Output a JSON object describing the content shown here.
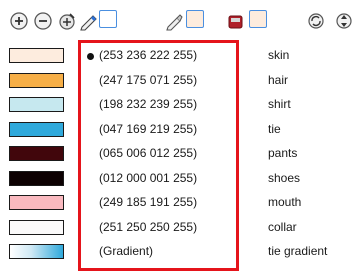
{
  "toolbar": {
    "icons": [
      "add-circle-icon",
      "remove-circle-icon",
      "style-picker-icon",
      "pencil-icon",
      "brush-icon",
      "paint-bucket-icon",
      "recycle-icon",
      "scroll-arrows-icon"
    ]
  },
  "colors": [
    {
      "name": "skin",
      "value": "(253 236 222 255)",
      "swatch": "#fdecde",
      "selected": true
    },
    {
      "name": "hair",
      "value": "(247 175 071 255)",
      "swatch": "#f7af47",
      "selected": false
    },
    {
      "name": "shirt",
      "value": "(198 232 239 255)",
      "swatch": "#c6e8ef",
      "selected": false
    },
    {
      "name": "tie",
      "value": "(047 169 219 255)",
      "swatch": "#2fa9db",
      "selected": false
    },
    {
      "name": "pants",
      "value": "(065 006 012 255)",
      "swatch": "#41060c",
      "selected": false
    },
    {
      "name": "shoes",
      "value": "(012 000 001 255)",
      "swatch": "#0c0001",
      "selected": false
    },
    {
      "name": "mouth",
      "value": "(249 185 191 255)",
      "swatch": "#f9b9bf",
      "selected": false
    },
    {
      "name": "collar",
      "value": "(251 250 250 255)",
      "swatch": "#fbfafa",
      "selected": false
    },
    {
      "name": "tie gradient",
      "value": "(Gradient)",
      "swatch": "gradient",
      "selected": false
    }
  ],
  "accent": {
    "highlight": "#e5141b",
    "swatch_button_border": "#4a8fe0"
  }
}
